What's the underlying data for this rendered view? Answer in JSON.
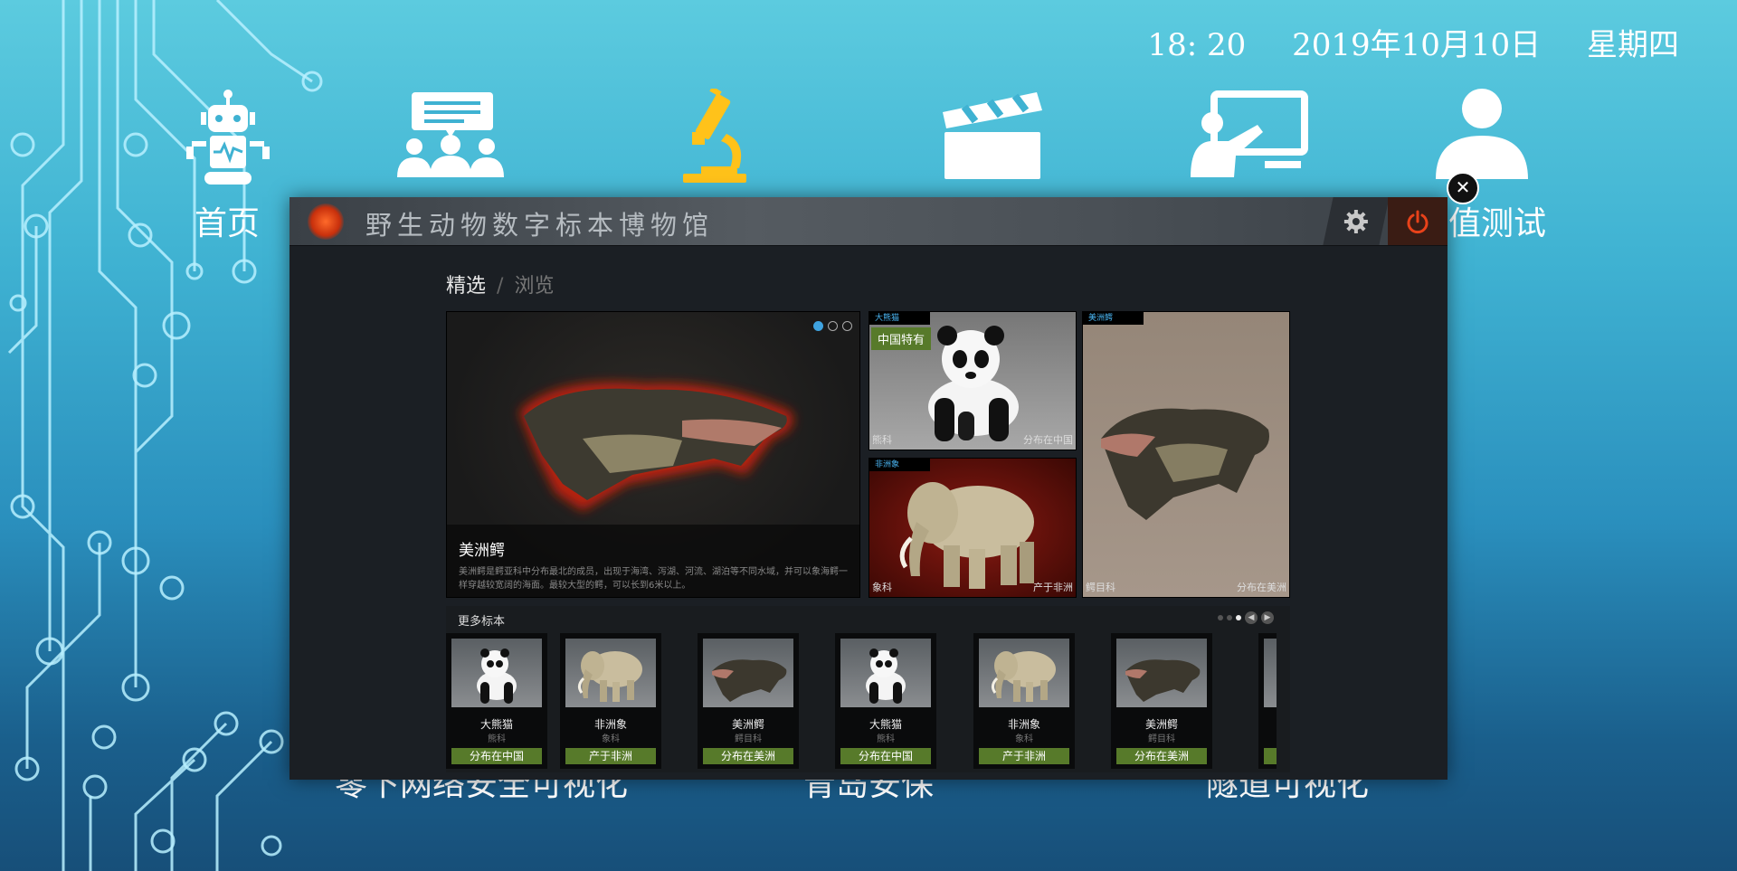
{
  "header": {
    "time": "18: 20",
    "date": "2019年10月10日",
    "weekday": "星期四"
  },
  "nav": {
    "items": [
      {
        "icon": "robot-icon",
        "label": "首页"
      },
      {
        "icon": "group-chat-icon"
      },
      {
        "icon": "microscope-icon"
      },
      {
        "icon": "clapperboard-icon"
      },
      {
        "icon": "presentation-icon"
      },
      {
        "icon": "user-icon",
        "label": "值测试"
      }
    ],
    "bottom_labels": [
      "零下网络安全可视化",
      "青岛安保",
      "隧道可视化"
    ]
  },
  "panel": {
    "title": "野生动物数字标本博物馆",
    "tabs": [
      "精选",
      "浏览"
    ],
    "tab_separator": "/",
    "feature": {
      "name": "美洲鳄",
      "description": "美洲鳄是鳄亚科中分布最北的成员，出现于海湾、泻湖、河流、湖泊等不同水域，并可以象海鳄一样穿越较宽阔的海面。最较大型的鳄，可以长到6米以上。",
      "slide_count": 3,
      "active_slide": 1
    },
    "cards": [
      {
        "tag": "大熊猫",
        "badge": "中国特有",
        "family": "熊科",
        "dist": "分布在中国"
      },
      {
        "tag": "非洲象",
        "family": "象科",
        "dist": "产于非洲"
      },
      {
        "tag": "美洲鳄",
        "family": "鳄目科",
        "dist": "分布在美洲"
      }
    ],
    "more": {
      "title": "更多标本",
      "items": [
        {
          "name": "大熊猫",
          "family": "熊科",
          "dist": "分布在中国",
          "kind": "panda"
        },
        {
          "name": "非洲象",
          "family": "象科",
          "dist": "产于非洲",
          "kind": "elephant"
        },
        {
          "name": "美洲鳄",
          "family": "鳄目科",
          "dist": "分布在美洲",
          "kind": "croc"
        },
        {
          "name": "大熊猫",
          "family": "熊科",
          "dist": "分布在中国",
          "kind": "panda"
        },
        {
          "name": "非洲象",
          "family": "象科",
          "dist": "产于非洲",
          "kind": "elephant"
        },
        {
          "name": "美洲鳄",
          "family": "鳄目科",
          "dist": "分布在美洲",
          "kind": "croc"
        }
      ]
    }
  },
  "colors": {
    "accent_green": "#577a2a",
    "accent_blue": "#3fa3e0",
    "power_red": "#e8421a"
  }
}
